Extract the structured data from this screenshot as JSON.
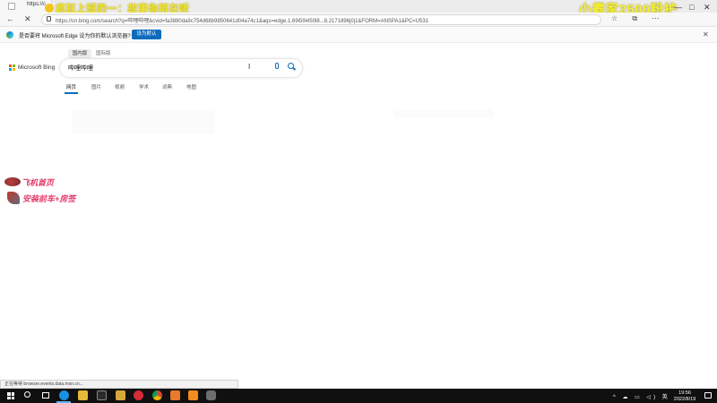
{
  "browser": {
    "tab_title": "https://c",
    "url": "https://cn.bing.com/search?q=哔哩哔哩&cvid=fa3880da9c754d68b9850641d04a74c1&aqs=edge.1.69i59i450l8...8.2171896j0j1&FORM=ANSPA1&PC=U531",
    "toolbar_icons": "☆ ⧉ ⋯"
  },
  "stream_overlay": {
    "left_banner": "疯狂上班的一：故事你再在听",
    "right_banner": "小霸家2500粉护",
    "sticker1": "飞机首页",
    "sticker2": "安装前车+房签"
  },
  "edge_banner": {
    "message": "是否要将 Microsoft Edge 设为你的默认浏览器?",
    "set_default_label": "设为默认"
  },
  "bing": {
    "brand": "Microsoft Bing",
    "region_tabs": [
      "国内版",
      "国际版"
    ],
    "query": "哔哩哔哩",
    "scopes": [
      "网页",
      "图片",
      "视频",
      "学术",
      "词典",
      "地图"
    ]
  },
  "status_bar": {
    "text": "正在等待 browser.events.data.msn.cn..."
  },
  "taskbar": {
    "time": "19:56",
    "date": "2022/8/19",
    "tray_icons": "^ ☁ ▭ ◁) 英"
  },
  "colors": {
    "accent": "#0f6cbd",
    "sticker_text": "#e23d6b",
    "overlay_text": "#f0e632"
  }
}
